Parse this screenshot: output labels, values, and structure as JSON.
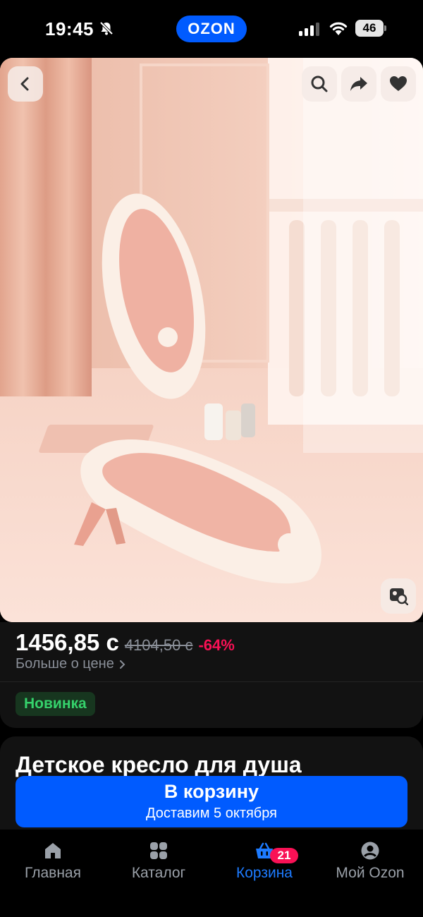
{
  "status_bar": {
    "time": "19:45",
    "app_logo": "OZON",
    "battery": "46",
    "icons": [
      "bell-muted-icon",
      "signal-icon",
      "wifi-icon",
      "battery-icon"
    ]
  },
  "gallery": {
    "icons": [
      "chevron-left-icon",
      "search-icon",
      "share-icon",
      "heart-icon",
      "image-search-icon"
    ]
  },
  "price": {
    "current": "1456,85 с",
    "old": "4104,50 с",
    "discount": "-64%",
    "more_label": "Больше о цене"
  },
  "badge": "Новинка",
  "product": {
    "title": "Детское кресло для душа"
  },
  "cta": {
    "label": "В корзину",
    "subtitle": "Доставим 5 октября"
  },
  "nav": {
    "items": [
      {
        "label": "Главная",
        "icon": "home-icon"
      },
      {
        "label": "Каталог",
        "icon": "catalog-icon"
      },
      {
        "label": "Корзина",
        "icon": "basket-icon",
        "badge": "21"
      },
      {
        "label": "Мой Ozon",
        "icon": "profile-icon"
      }
    ]
  },
  "colors": {
    "accent": "#005bff",
    "discount": "#f91155",
    "badge_text": "#35d26b",
    "active_nav": "#1d7bff"
  }
}
